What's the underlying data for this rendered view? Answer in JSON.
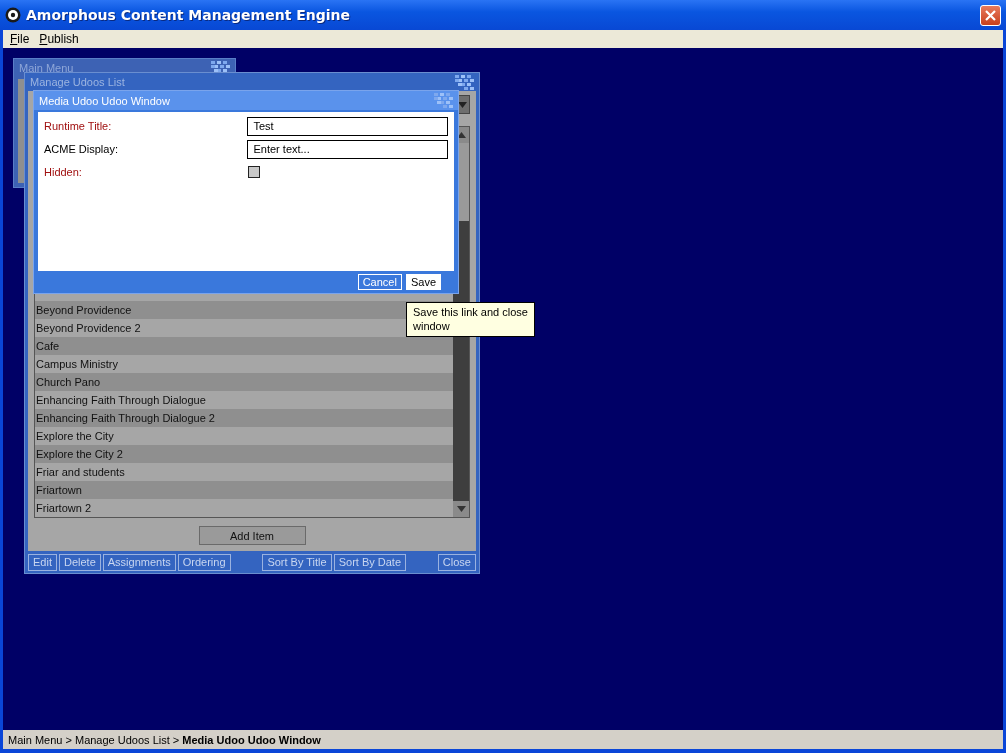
{
  "window": {
    "title": "Amorphous Content Management Engine"
  },
  "menu": [
    {
      "label": "File"
    },
    {
      "label": "Publish"
    }
  ],
  "main_menu_window": {
    "title": "Main Menu"
  },
  "list_window": {
    "title": "Manage Udoos List",
    "items": [
      "Beyond Providence",
      "Beyond Providence 2",
      "Cafe",
      "Campus Ministry",
      "Church Pano",
      "Enhancing Faith Through Dialogue",
      "Enhancing Faith Through Dialogue 2",
      "Explore the City",
      "Explore the City 2",
      "Friar and students",
      "Friartown",
      "Friartown 2"
    ],
    "add_button": "Add Item",
    "toolbar_groups": [
      {
        "buttons": [
          "Edit",
          "Delete",
          "Assignments",
          "Ordering"
        ]
      },
      {
        "buttons": [
          "Sort By Title",
          "Sort By Date"
        ]
      },
      {
        "buttons": [
          "Close"
        ]
      }
    ]
  },
  "dialog": {
    "title": "Media Udoo Udoo Window",
    "fields": [
      {
        "kind": "text",
        "label": "Runtime Title:",
        "required": true,
        "value": "Test"
      },
      {
        "kind": "text",
        "label": "ACME Display:",
        "required": false,
        "placeholder": "Enter text..."
      },
      {
        "kind": "checkbox",
        "label": "Hidden:",
        "required": true,
        "checked": false
      }
    ],
    "buttons": [
      {
        "label": "Cancel",
        "highlighted": false
      },
      {
        "label": "Save",
        "highlighted": true
      }
    ],
    "tooltip": "Save this link and close window"
  },
  "status_bar": {
    "separator": ">",
    "breadcrumbs": [
      {
        "label": "Main Menu",
        "current": false
      },
      {
        "label": "Manage Udoos List",
        "current": false
      },
      {
        "label": "Media Udoo Udoo Window",
        "current": true
      }
    ]
  }
}
